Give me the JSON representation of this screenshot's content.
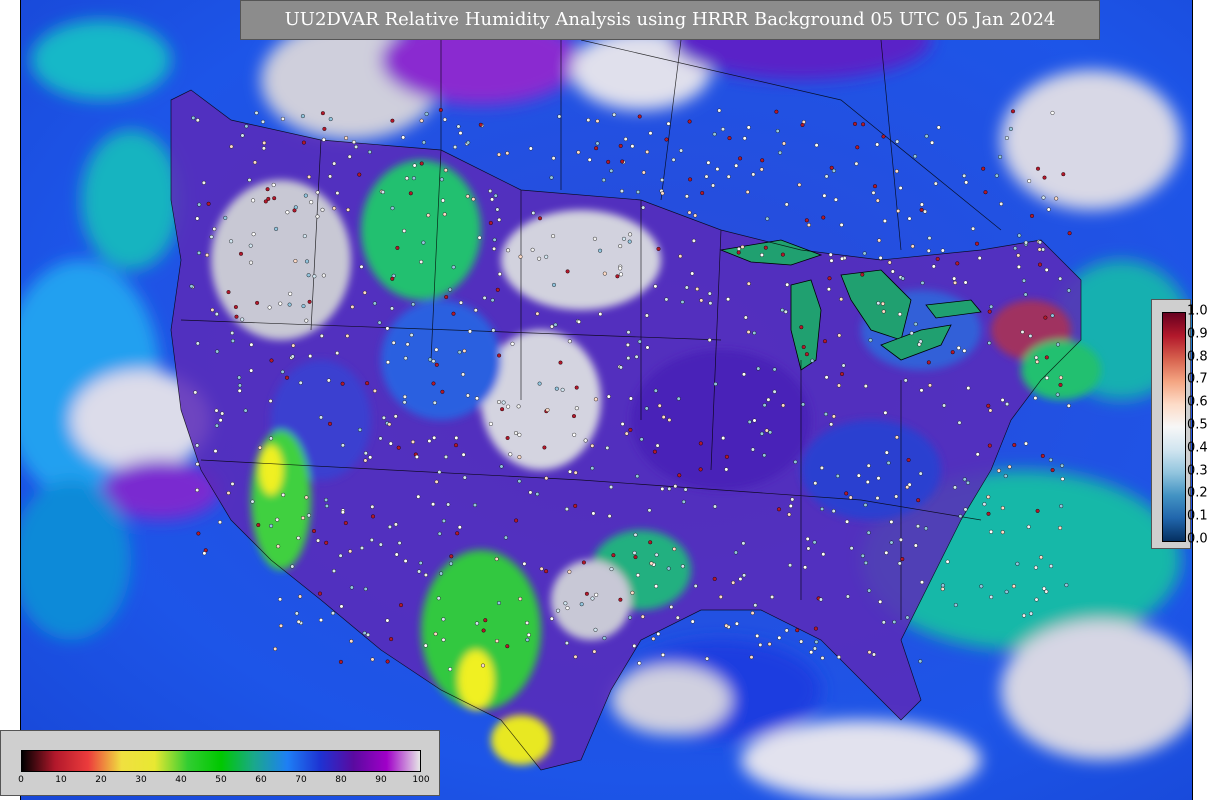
{
  "title": "UU2DVAR Relative Humidity Analysis using HRRR Background 05 UTC 05 Jan 2024",
  "humidity_colorbar": {
    "ticks": [
      "0",
      "10",
      "20",
      "30",
      "40",
      "50",
      "60",
      "70",
      "80",
      "90",
      "100"
    ],
    "colors": [
      "#000000",
      "#b2182b",
      "#ec3c3c",
      "#f0e040",
      "#e8e832",
      "#32cd32",
      "#00c800",
      "#1aa88c",
      "#1e7ff5",
      "#1e32d2",
      "#5a0aa0",
      "#a000c8",
      "#e6e6e6"
    ]
  },
  "observation_colorbar": {
    "ticks": [
      "1.0",
      "0.9",
      "0.8",
      "0.7",
      "0.6",
      "0.5",
      "0.4",
      "0.3",
      "0.2",
      "0.1",
      "0.0"
    ],
    "colors": [
      "#67001f",
      "#b2182b",
      "#d6604d",
      "#f4a582",
      "#fddbc7",
      "#f7f7f7",
      "#d1e5f0",
      "#92c5de",
      "#4393c3",
      "#2166ac",
      "#053061"
    ]
  },
  "map_colors": {
    "ocean": "#1e5ce6",
    "land_dry": "#c8c8d2",
    "land_moist": "#6e3cc8",
    "green": "#10c830",
    "yellow": "#f0f020",
    "lakes": "#20a070"
  }
}
